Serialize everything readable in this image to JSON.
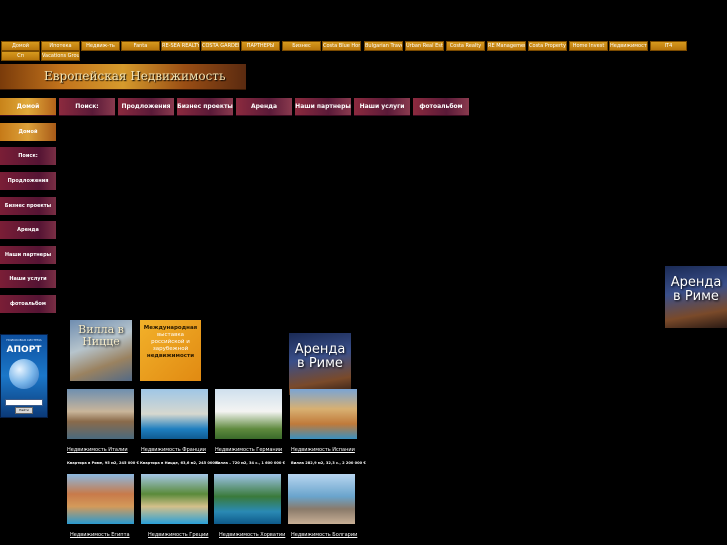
{
  "top_links": [
    "Домой",
    "Ипотека",
    "Недвиж-ть",
    "Fanta",
    "RE-SEA REALTY",
    "COSTA GARDEN",
    "ПАРТНЕРЫ",
    "Бизнес",
    "Costa Blue Home",
    "Bulgarian Travel",
    "Urban Real Estate",
    "Costa Realty",
    "RE Management",
    "Costa Property",
    "Home Invest",
    "Недвижимость",
    "IT4",
    "Сп",
    "Vacations Group"
  ],
  "banner": {
    "title": "Европейская Недвижимость"
  },
  "nav": [
    "Домой",
    "Поиск:",
    "Продложения",
    "Бизнес проекты",
    "Аренда",
    "Наши партнеры",
    "Наши услуги",
    "фотоальбом"
  ],
  "aport": {
    "small": "ПОИСКОВАЯ СИСТЕМА",
    "name": "АПОРТ",
    "button": "Найти"
  },
  "promos": {
    "nice": "Вилла в Ницце",
    "expo": [
      "Международная",
      "выставка",
      "российской и",
      "зарубежной",
      "недвижимости"
    ],
    "rome": "Аренда в Риме",
    "rome_side": "Аренда в Риме"
  },
  "row1": [
    {
      "caption": "Недвижимость Италии",
      "price": "Квартира в Риме, 95 м2, 245 000 €"
    },
    {
      "caption": "Недвижимость Франции",
      "price": "Квартира в Ницце, 63,6 м2, 245 000 €"
    },
    {
      "caption": "Недвижимость Германии",
      "price": "Вилла – 720 м2, 34 с., 1 600 000 €"
    },
    {
      "caption": "Недвижимость Испании",
      "price": "Вилла 282,9 м2, 32,3 с., 2 200 000 €"
    }
  ],
  "row2": [
    {
      "caption": "Недвижимость Египта"
    },
    {
      "caption": "Недвижимость Греции"
    },
    {
      "caption": "Недвижимость Хорватии"
    },
    {
      "caption": "Недвижимость Болгарии"
    }
  ],
  "colors": {
    "gold": "#d79a1e",
    "maroon": "#7a1e36",
    "background": "#000000"
  }
}
